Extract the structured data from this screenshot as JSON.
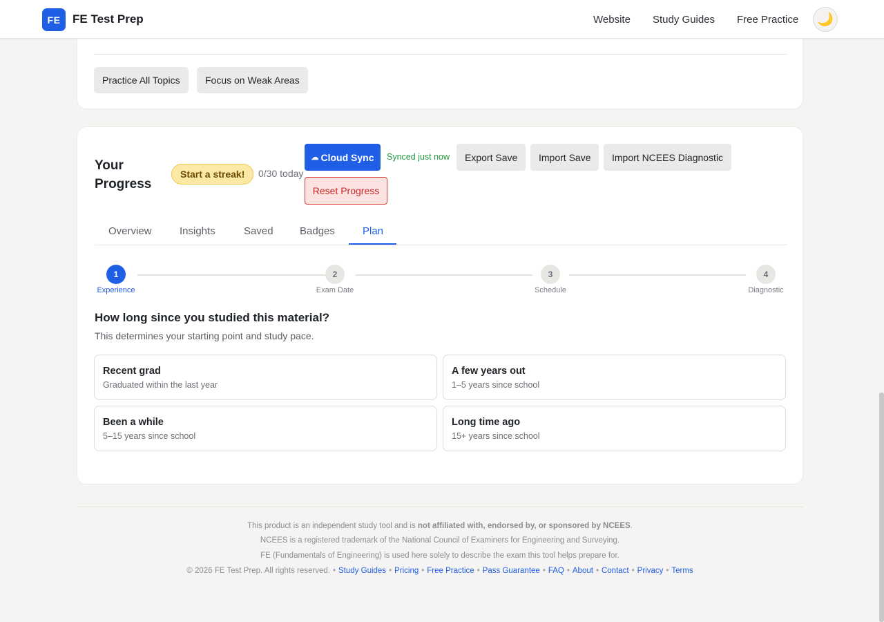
{
  "header": {
    "logo_text": "FE",
    "brand": "FE Test Prep",
    "nav": [
      "Website",
      "Study Guides",
      "Free Practice"
    ],
    "theme_icon": "moon-icon"
  },
  "top_card": {
    "buttons": [
      "Practice All Topics",
      "Focus on Weak Areas"
    ]
  },
  "progress": {
    "title": "Your Progress",
    "streak": "Start a streak!",
    "today": "0/30 today",
    "cloud_sync": "Cloud Sync",
    "synced": "Synced just now",
    "export": "Export Save",
    "import": "Import Save",
    "import_ncees": "Import NCEES Diagnostic",
    "reset": "Reset Progress",
    "tabs": [
      "Overview",
      "Insights",
      "Saved",
      "Badges",
      "Plan"
    ],
    "active_tab": "Plan",
    "steps": [
      {
        "num": "1",
        "label": "Experience"
      },
      {
        "num": "2",
        "label": "Exam Date"
      },
      {
        "num": "3",
        "label": "Schedule"
      },
      {
        "num": "4",
        "label": "Diagnostic"
      }
    ],
    "active_step": 1,
    "question": "How long since you studied this material?",
    "question_sub": "This determines your starting point and study pace.",
    "options": [
      {
        "title": "Recent grad",
        "sub": "Graduated within the last year"
      },
      {
        "title": "A few years out",
        "sub": "1–5 years since school"
      },
      {
        "title": "Been a while",
        "sub": "5–15 years since school"
      },
      {
        "title": "Long time ago",
        "sub": "15+ years since school"
      }
    ]
  },
  "footer": {
    "line1_pre": "This product is an independent study tool and is ",
    "line1_bold": "not affiliated with, endorsed by, or sponsored by NCEES",
    "line1_post": ".",
    "line2": "NCEES is a registered trademark of the National Council of Examiners for Engineering and Surveying.",
    "line3": "FE (Fundamentals of Engineering) is used here solely to describe the exam this tool helps prepare for.",
    "copyright": "© 2026 FE Test Prep. All rights reserved.",
    "links": [
      "Study Guides",
      "Pricing",
      "Free Practice",
      "Pass Guarantee",
      "FAQ",
      "About",
      "Contact",
      "Privacy",
      "Terms"
    ]
  },
  "colors": {
    "accent": "#1f5fe6",
    "streak_bg": "#fde9a6",
    "synced": "#1f9a3e",
    "danger": "#c62828"
  }
}
